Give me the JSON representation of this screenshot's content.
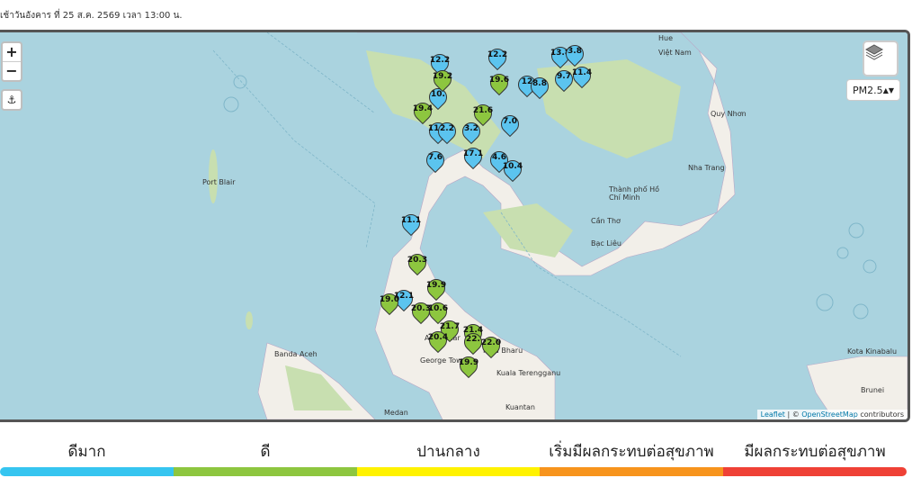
{
  "header": {
    "text": "เช้าวันอังคาร ที่ 25 ส.ค. 2569 เวลา 13:00 น."
  },
  "map": {
    "zoom_in": "+",
    "zoom_out": "−",
    "locate": "⚓",
    "layers_icon": "layers-icon",
    "pollutant_select": "PM2.5",
    "attribution": {
      "leaflet": "Leaflet",
      "sep": " | © ",
      "osm": "OpenStreetMap",
      "suffix": " contributors"
    },
    "place_labels": [
      "Port Blair",
      "Hue",
      "Việt Nam",
      "Quy Nhơn",
      "Nha Trang",
      "Thành phố Hồ Chí Minh",
      "Cần Thơ",
      "Bạc Liêu",
      "Banda Aceh",
      "George Town",
      "Kota Bharu",
      "Kuala Terengganu",
      "Kuantan",
      "Medan",
      "Kota Kinabalu",
      "Brunei",
      "Alor Setar"
    ],
    "markers": [
      {
        "value": "12.2",
        "level": "blue"
      },
      {
        "value": "12.2",
        "level": "blue"
      },
      {
        "value": "13.8",
        "level": "blue"
      },
      {
        "value": "3.8",
        "level": "blue"
      },
      {
        "value": "19.6",
        "level": "green"
      },
      {
        "value": "12",
        "level": "blue"
      },
      {
        "value": "8.8",
        "level": "blue"
      },
      {
        "value": "9.7",
        "level": "blue"
      },
      {
        "value": "11.4",
        "level": "blue"
      },
      {
        "value": "19.4",
        "level": "green"
      },
      {
        "value": "10.",
        "level": "blue"
      },
      {
        "value": "11.1",
        "level": "blue"
      },
      {
        "value": "21.6",
        "level": "green"
      },
      {
        "value": "7.0",
        "level": "blue"
      },
      {
        "value": "7.6",
        "level": "blue"
      },
      {
        "value": "17.1",
        "level": "blue"
      },
      {
        "value": "4.6",
        "level": "blue"
      },
      {
        "value": "10.4",
        "level": "blue"
      },
      {
        "value": "11.1",
        "level": "blue"
      },
      {
        "value": "20.3",
        "level": "green"
      },
      {
        "value": "19.9",
        "level": "green"
      },
      {
        "value": "12.1",
        "level": "blue"
      },
      {
        "value": "19.0",
        "level": "green"
      },
      {
        "value": "20.3",
        "level": "green"
      },
      {
        "value": "10.6",
        "level": "green"
      },
      {
        "value": "21.7",
        "level": "green"
      },
      {
        "value": "21.4",
        "level": "green"
      },
      {
        "value": "20.4",
        "level": "green"
      },
      {
        "value": "22.",
        "level": "green"
      },
      {
        "value": "22.0",
        "level": "green"
      },
      {
        "value": "19.9",
        "level": "green"
      },
      {
        "value": "19.2",
        "level": "green"
      },
      {
        "value": "2.2",
        "level": "blue"
      },
      {
        "value": "3.2",
        "level": "blue"
      }
    ]
  },
  "legend": [
    {
      "label": "ดีมาก",
      "color": "#36c5f0"
    },
    {
      "label": "ดี",
      "color": "#8dc63f"
    },
    {
      "label": "ปานกลาง",
      "color": "#fff200"
    },
    {
      "label": "เริ่มมีผลกระทบต่อสุขภาพ",
      "color": "#f7941d"
    },
    {
      "label": "มีผลกระทบต่อสุขภาพ",
      "color": "#ef4136"
    }
  ],
  "colors": {
    "blue": "#5bc4ef",
    "green": "#8dc63f",
    "land": "#f2efe9",
    "forest": "#b5d29f",
    "water": "#aad3df"
  }
}
